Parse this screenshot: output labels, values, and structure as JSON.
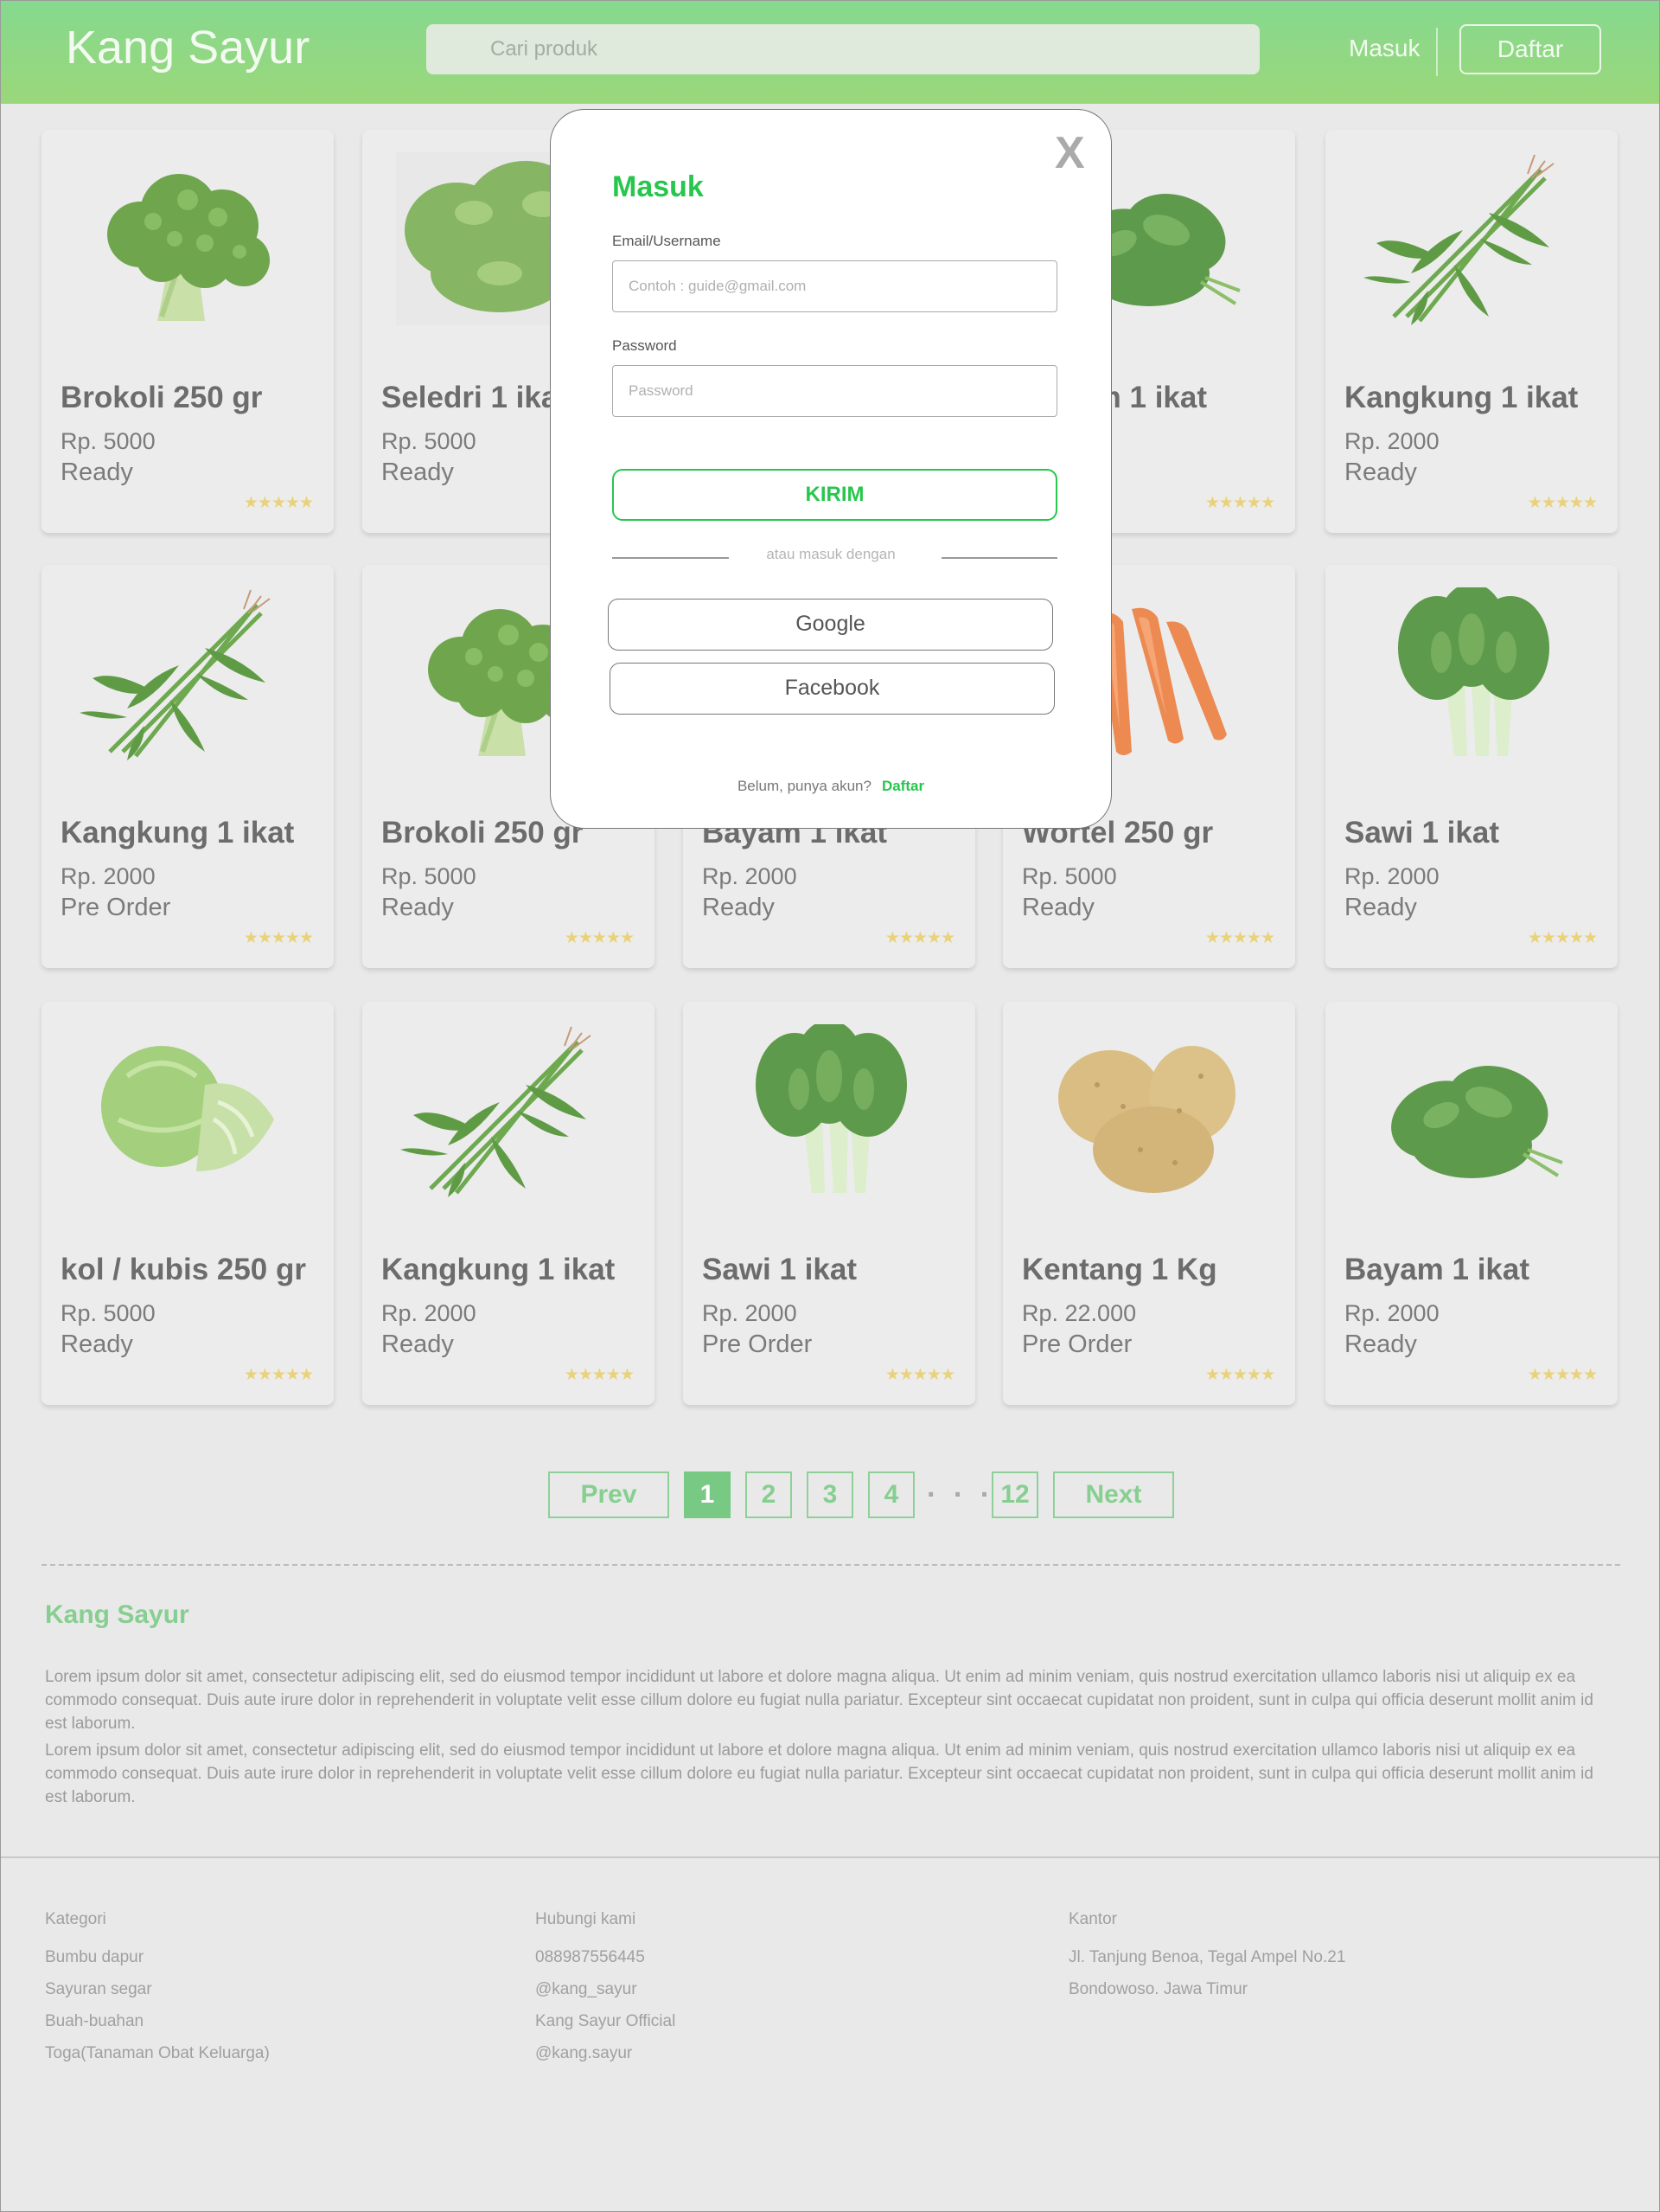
{
  "header": {
    "brand": "Kang Sayur",
    "search_placeholder": "Cari produk",
    "login": "Masuk",
    "register": "Daftar"
  },
  "products": [
    {
      "name": "Brokoli 250 gr",
      "price": "Rp. 5000",
      "status": "Ready",
      "image": "broccoli"
    },
    {
      "name": "Seledri 1 ikat",
      "price": "Rp. 5000",
      "status": "Ready",
      "image": "celery"
    },
    {
      "name": "",
      "price": "",
      "status": "",
      "image": "hidden-behind-modal"
    },
    {
      "name": "Bayam 1 ikat",
      "price": "",
      "status": "",
      "image": "spinach"
    },
    {
      "name": "Kangkung 1 ikat",
      "price": "Rp. 2000",
      "status": "Ready",
      "image": "water-spinach"
    },
    {
      "name": "Kangkung 1 ikat",
      "price": "Rp. 2000",
      "status": "Pre Order",
      "image": "water-spinach"
    },
    {
      "name": "Brokoli 250 gr",
      "price": "Rp. 5000",
      "status": "Ready",
      "image": "broccoli"
    },
    {
      "name": "Bayam 1 ikat",
      "price": "Rp. 2000",
      "status": "Ready",
      "image": "spinach"
    },
    {
      "name": "Wortel 250 gr",
      "price": "Rp. 5000",
      "status": "Ready",
      "image": "carrot"
    },
    {
      "name": "Sawi 1 ikat",
      "price": "Rp. 2000",
      "status": "Ready",
      "image": "bok-choy"
    },
    {
      "name": "kol / kubis 250 gr",
      "price": "Rp. 5000",
      "status": "Ready",
      "image": "cabbage"
    },
    {
      "name": "Kangkung 1 ikat",
      "price": "Rp. 2000",
      "status": "Ready",
      "image": "water-spinach"
    },
    {
      "name": "Sawi 1 ikat",
      "price": "Rp. 2000",
      "status": "Pre Order",
      "image": "bok-choy"
    },
    {
      "name": "Kentang 1 Kg",
      "price": "Rp. 22.000",
      "status": "Pre Order",
      "image": "potato"
    },
    {
      "name": "Bayam 1 ikat",
      "price": "Rp. 2000",
      "status": "Ready",
      "image": "spinach"
    }
  ],
  "rating_stars": "★★★★★",
  "pagination": {
    "prev": "Prev",
    "pages": [
      "1",
      "2",
      "3",
      "4"
    ],
    "ellipsis": ". . .",
    "last": "12",
    "next": "Next",
    "current": "1"
  },
  "about": {
    "title": "Kang Sayur",
    "paragraphs": [
      "Lorem ipsum dolor sit amet, consectetur adipiscing elit, sed do eiusmod tempor incididunt ut labore et dolore magna aliqua. Ut enim ad minim veniam, quis nostrud exercitation ullamco laboris nisi ut aliquip ex ea commodo consequat. Duis aute irure dolor in reprehenderit in voluptate velit esse cillum dolore eu fugiat nulla pariatur. Excepteur sint occaecat cupidatat non proident, sunt in culpa qui officia deserunt mollit anim id est laborum.",
      "Lorem ipsum dolor sit amet, consectetur adipiscing elit, sed do eiusmod tempor incididunt ut labore et dolore magna aliqua. Ut enim ad minim veniam, quis nostrud exercitation ullamco laboris nisi ut aliquip ex ea commodo consequat. Duis aute irure dolor in reprehenderit in voluptate velit esse cillum dolore eu fugiat nulla pariatur. Excepteur sint occaecat cupidatat non proident, sunt in culpa qui officia deserunt mollit anim id est laborum."
    ]
  },
  "footer": {
    "kategori": {
      "title": "Kategori",
      "items": [
        "Bumbu dapur",
        "Sayuran segar",
        "Buah-buahan",
        "Toga(Tanaman Obat Keluarga)"
      ]
    },
    "hubungi": {
      "title": "Hubungi kami",
      "items": [
        "088987556445",
        "@kang_sayur",
        "Kang Sayur Official",
        "@kang.sayur"
      ]
    },
    "kantor": {
      "title": "Kantor",
      "items": [
        "Jl. Tanjung Benoa, Tegal Ampel No.21",
        "Bondowoso. Jawa Timur"
      ]
    }
  },
  "modal": {
    "close": "X",
    "title": "Masuk",
    "email_label": "Email/Username",
    "email_placeholder": "Contoh : guide@gmail.com",
    "password_label": "Password",
    "password_placeholder": "Password",
    "submit": "KIRIM",
    "divider_text": "atau masuk dengan",
    "google": "Google",
    "facebook": "Facebook",
    "no_account": "Belum, punya akun?",
    "register_link": "Daftar"
  },
  "colors": {
    "brand_green": "#27c64d",
    "header_green": "#8fd98a",
    "star_yellow": "#e9d27a"
  }
}
